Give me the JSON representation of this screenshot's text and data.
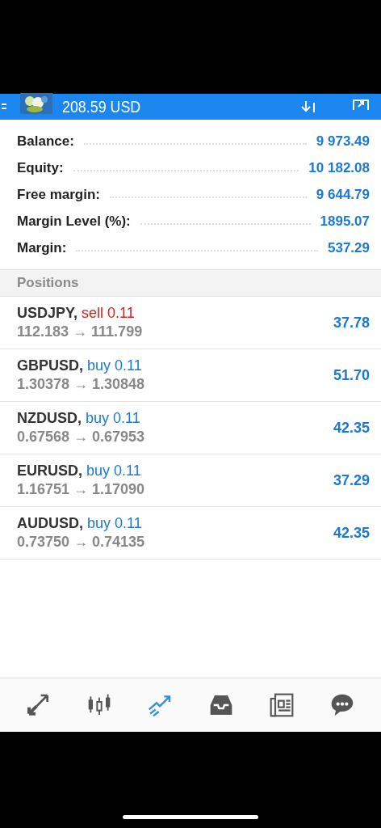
{
  "header": {
    "title": "208.59 USD"
  },
  "summary": [
    {
      "label": "Balance:",
      "value": "9 973.49"
    },
    {
      "label": "Equity:",
      "value": "10 182.08"
    },
    {
      "label": "Free margin:",
      "value": "9 644.79"
    },
    {
      "label": "Margin Level (%):",
      "value": "1895.07"
    },
    {
      "label": "Margin:",
      "value": "537.29"
    }
  ],
  "positions_heading": "Positions",
  "positions": [
    {
      "symbol": "USDJPY,",
      "kind": "sell",
      "order": "sell 0.11",
      "prices": "112.183 → 111.799",
      "profit": "37.78"
    },
    {
      "symbol": "GBPUSD,",
      "kind": "buy",
      "order": "buy 0.11",
      "prices": "1.30378 → 1.30848",
      "profit": "51.70"
    },
    {
      "symbol": "NZDUSD,",
      "kind": "buy",
      "order": "buy 0.11",
      "prices": "0.67568 → 0.67953",
      "profit": "42.35"
    },
    {
      "symbol": "EURUSD,",
      "kind": "buy",
      "order": "buy 0.11",
      "prices": "1.16751 → 1.17090",
      "profit": "37.29"
    },
    {
      "symbol": "AUDUSD,",
      "kind": "buy",
      "order": "buy 0.11",
      "prices": "0.73750 → 0.74135",
      "profit": "42.35"
    }
  ],
  "nav": [
    {
      "kind": "quotes",
      "selected": false
    },
    {
      "kind": "chart",
      "selected": false
    },
    {
      "kind": "trade",
      "selected": true
    },
    {
      "kind": "history",
      "selected": false
    },
    {
      "kind": "news",
      "selected": false
    },
    {
      "kind": "chat",
      "selected": false
    }
  ]
}
